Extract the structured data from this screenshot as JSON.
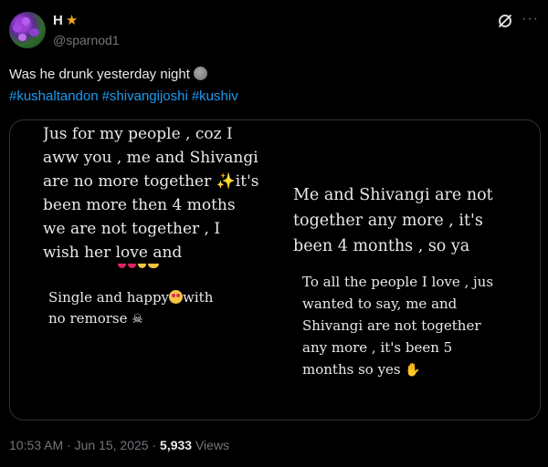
{
  "author": {
    "display_name": "H",
    "star_icon": "star-emoji-icon",
    "handle": "@sparnod1"
  },
  "header_icons": {
    "grok": "grok-icon",
    "more": "···"
  },
  "tweet": {
    "text": "Was he drunk yesterday night",
    "emoji": "moon-face-icon",
    "hashtags": [
      "#kushaltandon",
      "#shivangijoshi",
      "#kushiv"
    ]
  },
  "media": {
    "story_left": "Jus for my people , coz I\naww you , me and Shivangi\nare no more together ✨it's\nbeen more then 4 moths\nwe are not together , I\nwish her love and",
    "story_right": "Me and Shivangi are not\ntogether any more , it's\nbeen 4 months , so ya",
    "overlay_single_line1": "Single and happy",
    "overlay_single_line2": "with",
    "overlay_single_line3": "no remorse",
    "overlay_right": "To all the people I love , jus\nwanted to say, me and\nShivangi are not together\nany more , it's been 5\nmonths so yes"
  },
  "footer": {
    "time": "10:53 AM",
    "sep1": " · ",
    "date": "Jun 15, 2025",
    "sep2": " · ",
    "views_count": "5,933",
    "views_label": " Views"
  }
}
